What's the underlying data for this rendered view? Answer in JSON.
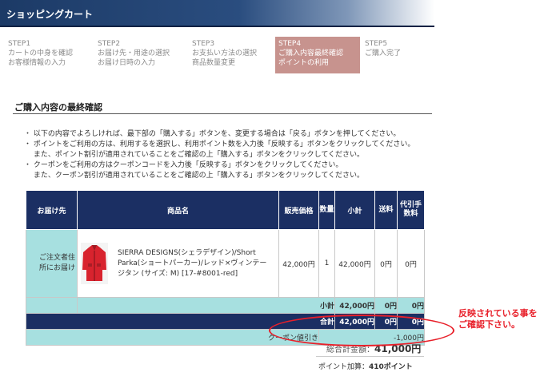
{
  "header": {
    "title": "ショッピングカート"
  },
  "steps": [
    {
      "label": "STEP1",
      "lines": [
        "カートの中身を確認",
        "お客様情報の入力"
      ]
    },
    {
      "label": "STEP2",
      "lines": [
        "お届け先・用途の選択",
        "お届け日時の入力"
      ]
    },
    {
      "label": "STEP3",
      "lines": [
        "お支払い方法の選択",
        "商品数量変更"
      ]
    },
    {
      "label": "STEP4",
      "lines": [
        "ご購入内容最終確認",
        "ポイントの利用"
      ],
      "active": true
    },
    {
      "label": "STEP5",
      "lines": [
        "ご購入完了"
      ]
    }
  ],
  "section_title": "ご購入内容の最終確認",
  "notices": [
    "・ 以下の内容でよろしければ、最下部の「購入する」ボタンを、変更する場合は「戻る」ボタンを押してください。",
    "・ ポイントをご利用の方は、利用するを選択し、利用ポイント数を入力後「反映する」ボタンをクリックしてください。",
    "　 また、ポイント割引が適用されていることをご確認の上「購入する」ボタンをクリックしてください。",
    "・ クーポンをご利用の方はクーポンコードを入力後「反映する」ボタンをクリックしてください。",
    "　 また、クーポン割引が適用されていることをご確認の上「購入する」ボタンをクリックしてください。"
  ],
  "table": {
    "headers": {
      "dest": "お届け先",
      "product": "商品名",
      "price": "販売価格",
      "qty": "数量",
      "subtotal": "小計",
      "shipping": "送料",
      "cod_fee": "代引手数料"
    },
    "row": {
      "dest": "ご注文者住所にお届け",
      "product_name": "SIERRA DESIGNS(シェラデザイン)/Short Parka(ショートパーカー)/レッド×ヴィンテージタン (サイズ: M) [17-#8001-red]",
      "price": "42,000円",
      "qty": "1",
      "subtotal": "42,000円",
      "shipping": "0円",
      "cod_fee": "0円"
    },
    "sum_row": {
      "label": "小計",
      "subtotal": "42,000円",
      "shipping": "0円",
      "cod_fee": "0円"
    },
    "total_row": {
      "label": "合計",
      "subtotal": "42,000円",
      "shipping": "0円",
      "cod_fee": "0円"
    },
    "coupon_row": {
      "label": "クーポン値引き",
      "value": "-1,000円"
    }
  },
  "grand_total": {
    "label": "総合計金額：",
    "value": "41,000円"
  },
  "points": {
    "label": "ポイント加算：",
    "value": "410ポイント"
  },
  "annotation": [
    "反映されている事を",
    "ご確認下さい。"
  ],
  "colors": {
    "header_navy": "#1b2f63",
    "row_cyan": "#a7e0e0",
    "active_step": "#c7938e",
    "annotation_red": "#e8202a"
  }
}
